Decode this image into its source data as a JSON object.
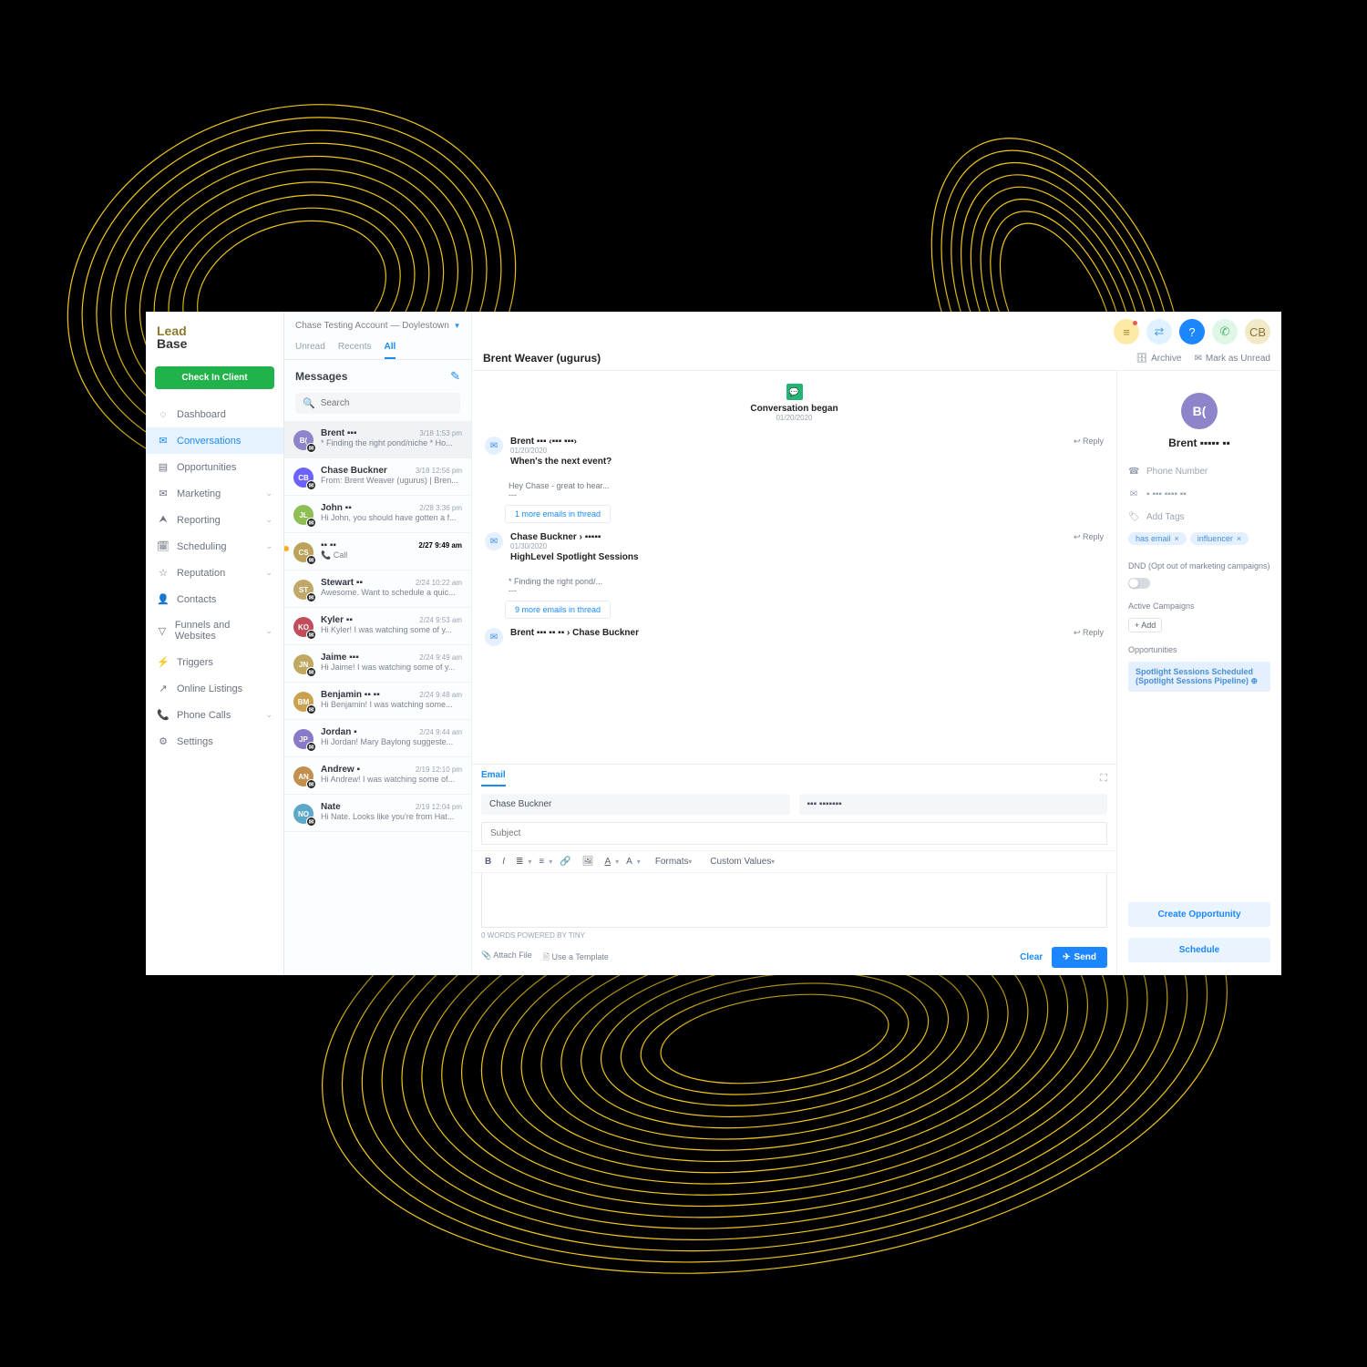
{
  "brand": {
    "line1": "Lead",
    "line2": "Base"
  },
  "checkin_label": "Check In Client",
  "account": {
    "name": "Chase Testing Account — Doylestown"
  },
  "nav": [
    {
      "icon": "◌",
      "label": "Dashboard"
    },
    {
      "icon": "✉",
      "label": "Conversations",
      "active": true
    },
    {
      "icon": "▤",
      "label": "Opportunities"
    },
    {
      "icon": "✉",
      "label": "Marketing",
      "chevron": true
    },
    {
      "icon": "⮝",
      "label": "Reporting",
      "chevron": true
    },
    {
      "icon": "🗓",
      "label": "Scheduling",
      "chevron": true
    },
    {
      "icon": "☆",
      "label": "Reputation",
      "chevron": true
    },
    {
      "icon": "👤",
      "label": "Contacts"
    },
    {
      "icon": "▽",
      "label": "Funnels and Websites",
      "chevron": true
    },
    {
      "icon": "⚡",
      "label": "Triggers"
    },
    {
      "icon": "↗",
      "label": "Online Listings"
    },
    {
      "icon": "📞",
      "label": "Phone Calls",
      "chevron": true
    },
    {
      "icon": "⚙",
      "label": "Settings"
    }
  ],
  "tabs": [
    {
      "label": "Unread"
    },
    {
      "label": "Recents"
    },
    {
      "label": "All",
      "active": true
    }
  ],
  "messages_title": "Messages",
  "search_placeholder": "Search",
  "conversations": [
    {
      "initials": "B(",
      "color": "#8d84c9",
      "name": "Brent ▪▪▪",
      "time": "3/18 1:53 pm",
      "preview": "* Finding the right pond/niche * Ho...",
      "selected": true
    },
    {
      "initials": "CB",
      "color": "#6c63ff",
      "name": "Chase Buckner",
      "time": "3/18 12:56 pm",
      "preview": "From: Brent Weaver (ugurus) | Bren..."
    },
    {
      "initials": "JL",
      "color": "#8fbf54",
      "name": "John ▪▪",
      "time": "2/28 3:36 pm",
      "preview": "Hi John, you should have gotten a f..."
    },
    {
      "initials": "CS",
      "color": "#bda25a",
      "name": "▪▪ ▪▪",
      "time": "2/27 9:49 am",
      "preview": "📞 Call",
      "unread": true,
      "bold": true
    },
    {
      "initials": "ST",
      "color": "#c2a76b",
      "name": "Stewart ▪▪",
      "time": "2/24 10:22 am",
      "preview": "Awesome. Want to schedule a quic..."
    },
    {
      "initials": "KO",
      "color": "#c14d5b",
      "name": "Kyler ▪▪",
      "time": "2/24 9:53 am",
      "preview": "Hi Kyler! I was watching some of y..."
    },
    {
      "initials": "JN",
      "color": "#c0a861",
      "name": "Jaime ▪▪▪",
      "time": "2/24 9:49 am",
      "preview": "Hi Jaime! I was watching some of y..."
    },
    {
      "initials": "BM",
      "color": "#c9a14f",
      "name": "Benjamin ▪▪ ▪▪",
      "time": "2/24 9:48 am",
      "preview": "Hi Benjamin! I was watching some..."
    },
    {
      "initials": "JP",
      "color": "#8a78c9",
      "name": "Jordan ▪",
      "time": "2/24 9:44 am",
      "preview": "Hi Jordan! Mary Baylong suggeste..."
    },
    {
      "initials": "AN",
      "color": "#c28f4e",
      "name": "Andrew ▪",
      "time": "2/19 12:10 pm",
      "preview": "Hi Andrew! I was watching some of..."
    },
    {
      "initials": "NO",
      "color": "#5da7c8",
      "name": "Nate",
      "time": "2/19 12:04 pm",
      "preview": "Hi Nate. Looks like you're from Hat..."
    }
  ],
  "contact_title": "Brent Weaver (ugurus)",
  "header_actions": {
    "archive": "Archive",
    "mark_unread": "Mark as Unread"
  },
  "conversation_began": {
    "label": "Conversation began",
    "date": "01/20/2020"
  },
  "thread": [
    {
      "from": "Brent ▪▪▪ ‹▪▪▪ ▪▪▪›",
      "date": "01/20/2020",
      "subject": "When's the next event?",
      "excerpt": "Hey Chase - great to hear...",
      "more": "1 more emails in thread"
    },
    {
      "from": "Chase Buckner › ▪▪▪▪▪",
      "date": "01/30/2020",
      "subject": "HighLevel Spotlight Sessions",
      "excerpt": "* Finding the right pond/...",
      "more": "9 more emails in thread"
    },
    {
      "from": "Brent ▪▪▪ ▪▪ ▪▪ › Chase Buckner",
      "date": "",
      "subject": "",
      "reply_only": true
    }
  ],
  "reply_label": "↩ Reply",
  "composer": {
    "tab": "Email",
    "from": "Chase Buckner",
    "to": "▪▪▪ ▪▪▪▪▪▪▪",
    "subject_placeholder": "Subject",
    "formats": "Formats",
    "custom": "Custom Values",
    "footer": "0 WORDS POWERED BY TINY",
    "attach": "Attach File",
    "template": "Use a Template",
    "clear": "Clear",
    "send": "Send"
  },
  "right": {
    "initials": "B(",
    "name": "Brent ▪▪▪▪▪ ▪▪",
    "phone_ph": "Phone Number",
    "email": "▪ ▪▪▪ ▪▪▪▪ ▪▪",
    "add_tags_ph": "Add Tags",
    "tags": [
      {
        "t": "has email"
      },
      {
        "t": "influencer"
      }
    ],
    "dnd_label": "DND (Opt out of marketing campaigns)",
    "active_label": "Active Campaigns",
    "add": "+ Add",
    "opps_label": "Opportunities",
    "opportunity": "Spotlight Sessions Scheduled (Spotlight Sessions Pipeline) ⊕",
    "create_opp": "Create Opportunity",
    "schedule": "Schedule"
  }
}
